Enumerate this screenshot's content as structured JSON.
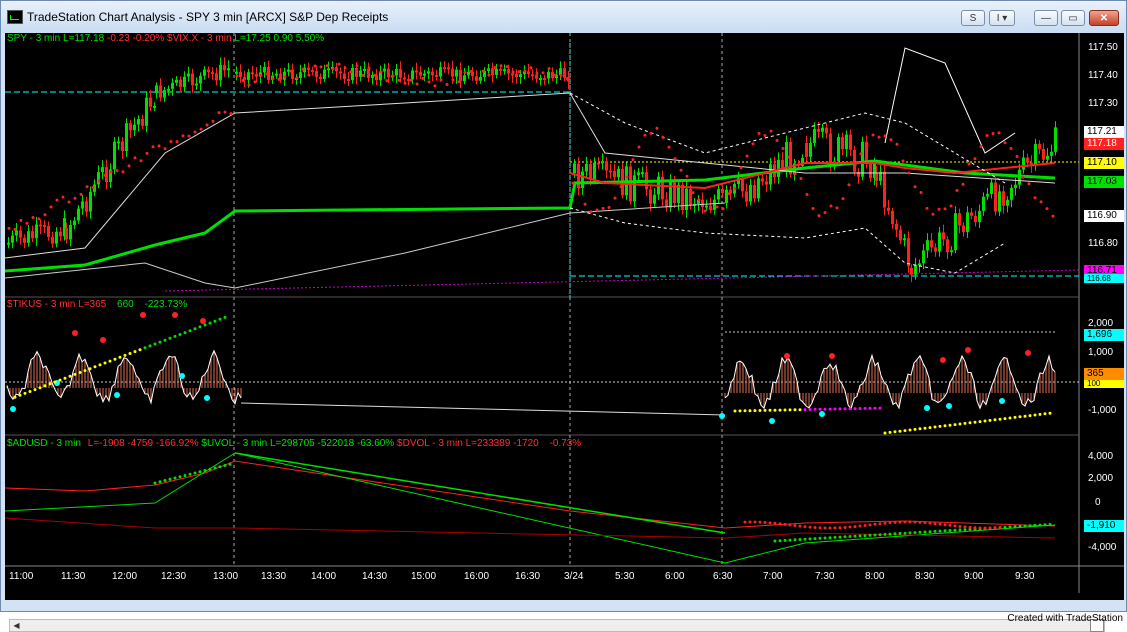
{
  "window": {
    "title": "TradeStation Chart Analysis - SPY 3 min [ARCX] S&P Dep Receipts",
    "btn_s": "S",
    "btn_arrow": "I ▾",
    "btn_min": "—",
    "btn_max": "▭",
    "btn_close": "✕"
  },
  "panel1": {
    "symbol": "SPY - 3 min",
    "last": "L=117.18",
    "chg": "-0.23",
    "pct": "-0.20%",
    "symbol2": "$VIX.X - 3 min",
    "last2": "L=17.25",
    "chg2": "0.90",
    "pct2": "5.50%",
    "axis": [
      "117.50",
      "117.40",
      "117.30",
      "116.90",
      "116.80"
    ],
    "boxes": [
      "117.21",
      "117.18",
      "117.10",
      "117.03",
      "116.90",
      "116.71",
      "116.68"
    ]
  },
  "panel2": {
    "symbol": "$TIKUS - 3 min",
    "last": "L=365",
    "v1": "660",
    "pct": "-223.73%",
    "axis": [
      "2,000",
      "1,000",
      "100",
      "-1,000"
    ],
    "boxes": [
      "1,696",
      "365"
    ]
  },
  "panel3": {
    "symbol": "$ADUSD - 3 min",
    "last": "L=-1908",
    "v1": "-4759",
    "pct": "-166.92%",
    "symbol2": "$UVOL - 3 min",
    "last2": "L=298705",
    "v2": "-522018",
    "pct2": "-63.60%",
    "symbol3": "$DVOL - 3 min",
    "last3": "L=233389",
    "v3": "-1720",
    "pct3": "-0.73%",
    "axis": [
      "4,000",
      "2,000",
      "0",
      "-4,000"
    ],
    "boxes": [
      "-1,910"
    ]
  },
  "time_axis": [
    "11:00",
    "11:30",
    "12:00",
    "12:30",
    "13:00",
    "13:30",
    "14:00",
    "14:30",
    "15:00",
    "16:00",
    "16:30",
    "3/24",
    "5:30",
    "6:00",
    "6:30",
    "7:00",
    "7:30",
    "8:00",
    "8:30",
    "9:00",
    "9:30"
  ],
  "colors": {
    "up": "#00e000",
    "down": "#ff2020",
    "vix": "#ff2020",
    "bg": "#000000",
    "accent_magenta": "#ff00ff",
    "accent_cyan": "#00ffff"
  },
  "footer": "Created with TradeStation"
}
